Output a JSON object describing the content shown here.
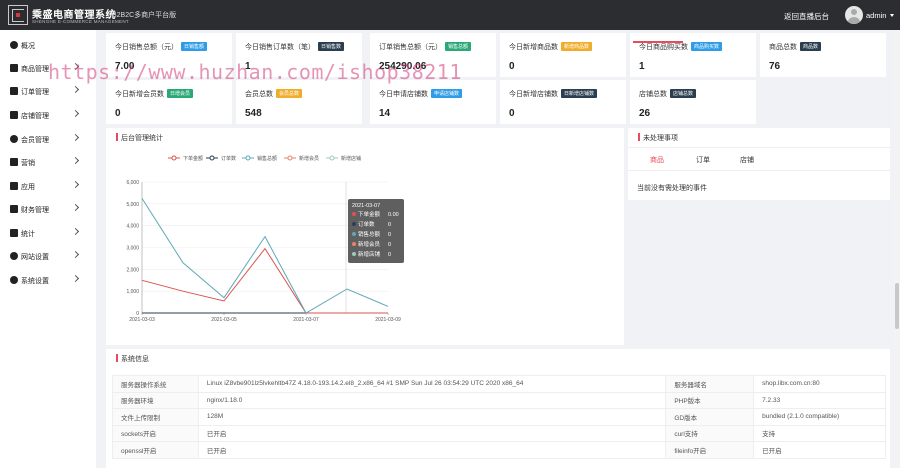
{
  "header": {
    "brand_name": "乘盛电商管理系统",
    "brand_sub": "SHENGHE E-COMMERCE MANAGEMENT",
    "brand_tag": "B2B2C多商户平台版",
    "live_link": "返回直播后台",
    "user": "admin"
  },
  "sidebar": {
    "items": [
      {
        "label": "概况",
        "icon": "dashboard-icon",
        "arrow": false
      },
      {
        "label": "商品管理",
        "icon": "goods-icon",
        "arrow": true
      },
      {
        "label": "订单管理",
        "icon": "order-icon",
        "arrow": true
      },
      {
        "label": "店铺管理",
        "icon": "store-icon",
        "arrow": true
      },
      {
        "label": "会员管理",
        "icon": "member-icon",
        "arrow": true
      },
      {
        "label": "营销",
        "icon": "marketing-icon",
        "arrow": true
      },
      {
        "label": "应用",
        "icon": "app-icon",
        "arrow": true
      },
      {
        "label": "财务管理",
        "icon": "finance-icon",
        "arrow": true
      },
      {
        "label": "统计",
        "icon": "stats-icon",
        "arrow": true
      },
      {
        "label": "网站设置",
        "icon": "website-settings-icon",
        "arrow": true
      },
      {
        "label": "系统设置",
        "icon": "system-settings-icon",
        "arrow": true
      }
    ]
  },
  "stats": [
    {
      "label": "今日销售总额（元）",
      "tag": "日销售额",
      "tag_color": "#2f9ce8",
      "value": "7.00"
    },
    {
      "label": "今日销售订单数（笔）",
      "tag": "日销售数",
      "tag_color": "#2b3e50",
      "value": "1"
    },
    {
      "label": "订单销售总额（元）",
      "tag": "销售总额",
      "tag_color": "#2aa876",
      "value": "254290.06"
    },
    {
      "label": "今日新增商品数",
      "tag": "新增商品数",
      "tag_color": "#f0ad2c",
      "value": "0"
    },
    {
      "label": "今日商品购买数",
      "tag": "商品购买数",
      "tag_color": "#2f9ce8",
      "value": "1"
    },
    {
      "label": "商品总数",
      "tag": "商品数",
      "tag_color": "#2b3e50",
      "value": "76"
    },
    {
      "label": "今日新增会员数",
      "tag": "日增会员",
      "tag_color": "#2aa876",
      "value": "0"
    },
    {
      "label": "会员总数",
      "tag": "会员总数",
      "tag_color": "#f0ad2c",
      "value": "548"
    },
    {
      "label": "今日申请店铺数",
      "tag": "申请店铺数",
      "tag_color": "#2f9ce8",
      "value": "14"
    },
    {
      "label": "今日新增店铺数",
      "tag": "日新增店铺数",
      "tag_color": "#2b3e50",
      "value": "0"
    },
    {
      "label": "店铺总数",
      "tag": "店铺总数",
      "tag_color": "#2b3e50",
      "value": "26"
    }
  ],
  "chart_panel": {
    "title": "后台管理统计"
  },
  "chart_data": {
    "type": "line",
    "x": [
      "2021-03-03",
      "2021-03-04",
      "2021-03-05",
      "2021-03-06",
      "2021-03-07",
      "2021-03-08",
      "2021-03-09"
    ],
    "x_tick_labels": [
      "2021-03-03",
      "2021-03-05",
      "2021-03-07",
      "2021-03-09"
    ],
    "ylim": [
      0,
      6000
    ],
    "y_ticks": [
      0,
      1000,
      2000,
      3000,
      4000,
      5000,
      6000
    ],
    "y_tick_labels": [
      "0",
      "1,000",
      "2,000",
      "3,000",
      "4,000",
      "5,000",
      "6,000"
    ],
    "legend_position": "top",
    "series": [
      {
        "name": "下单金额",
        "color": "#d9534f",
        "values": [
          1500,
          1000,
          550,
          2950,
          0,
          0,
          0
        ]
      },
      {
        "name": "订单数",
        "color": "#2b3e50",
        "values": [
          1,
          1,
          1,
          1,
          0,
          1,
          1
        ]
      },
      {
        "name": "销售总额",
        "color": "#5fa8b5",
        "values": [
          5250,
          2300,
          700,
          3500,
          0,
          1100,
          300
        ]
      },
      {
        "name": "新增会员",
        "color": "#e8826a",
        "values": [
          0,
          0,
          0,
          0,
          0,
          0,
          0
        ]
      },
      {
        "name": "新增店铺",
        "color": "#9fc9bd",
        "values": [
          0,
          0,
          0,
          0,
          0,
          0,
          0
        ]
      }
    ],
    "tooltip": {
      "date": "2021-03-07",
      "rows": [
        {
          "label": "下单金额",
          "value": "0.00",
          "color": "#d9534f"
        },
        {
          "label": "订单数",
          "value": "0",
          "color": "#2b3e50"
        },
        {
          "label": "销售总额",
          "value": "0",
          "color": "#5fa8b5"
        },
        {
          "label": "新增会员",
          "value": "0",
          "color": "#e8826a"
        },
        {
          "label": "新增店铺",
          "value": "0",
          "color": "#9fc9bd"
        }
      ]
    }
  },
  "todo": {
    "title": "未处理事项",
    "tabs": [
      "商品",
      "订单",
      "店铺"
    ],
    "active_tab": "商品",
    "empty_text": "当前没有需处理的事件"
  },
  "system": {
    "title": "系统信息",
    "rows": [
      {
        "k1": "服务器操作系统",
        "v1": "Linux iZ8vbe901lz5lvkehltb47Z 4.18.0-193.14.2.el8_2.x86_64 #1 SMP Sun Jul 26 03:54:29 UTC 2020 x86_64",
        "k2": "服务器域名",
        "v2": "shop.libx.com.cn:80"
      },
      {
        "k1": "服务器环境",
        "v1": "nginx/1.18.0",
        "k2": "PHP版本",
        "v2": "7.2.33"
      },
      {
        "k1": "文件上传限制",
        "v1": "128M",
        "k2": "GD版本",
        "v2": "bundled (2.1.0 compatible)"
      },
      {
        "k1": "sockets开启",
        "v1": "已开启",
        "k2": "curl支持",
        "v2": "支持"
      },
      {
        "k1": "openssl开启",
        "v1": "已开启",
        "k2": "fileinfo开启",
        "v2": "已开启"
      }
    ]
  },
  "watermark": "https://www.huzhan.com/ishop38211"
}
